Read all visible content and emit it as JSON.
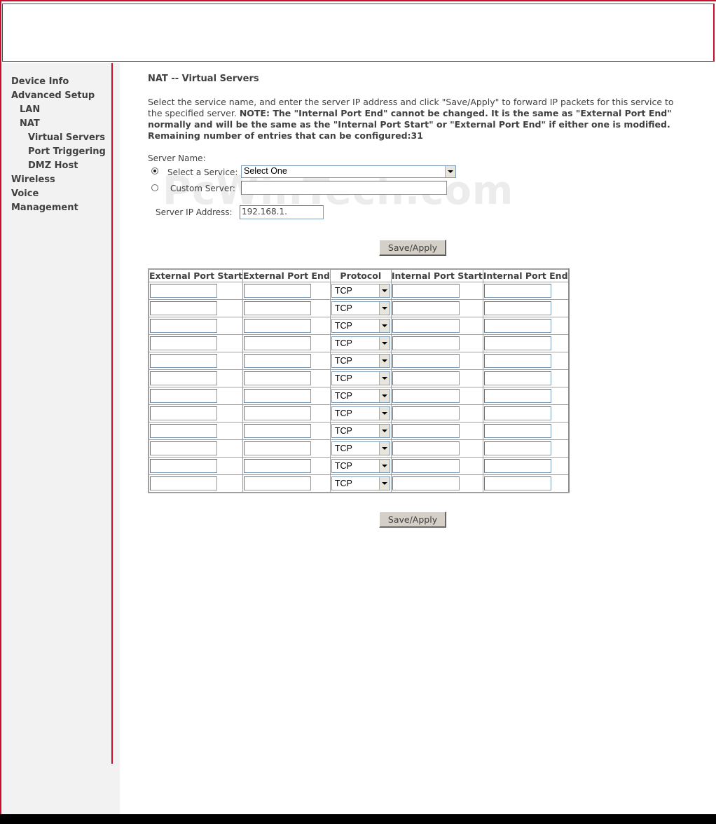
{
  "sidebar": {
    "items": [
      {
        "label": "Device Info"
      },
      {
        "label": "Advanced Setup"
      },
      {
        "label": "LAN"
      },
      {
        "label": "NAT"
      },
      {
        "label": "Virtual Servers"
      },
      {
        "label": "Port Triggering"
      },
      {
        "label": "DMZ Host"
      },
      {
        "label": "Wireless"
      },
      {
        "label": "Voice"
      },
      {
        "label": "Management"
      }
    ]
  },
  "page": {
    "title": "NAT -- Virtual Servers",
    "desc_part1": "Select the service name, and enter the server IP address and click \"Save/Apply\" to forward IP packets for this service to the specified server. ",
    "desc_note": "NOTE: The \"Internal Port End\" cannot be changed. It is the same as \"External Port End\" normally and will be the same as the \"Internal Port Start\" or \"External Port End\" if either one is modified.",
    "remaining": "Remaining number of entries that can be configured:31"
  },
  "form": {
    "server_name_label": "Server Name:",
    "select_service_label": "Select a Service:",
    "select_service_value": "Select One",
    "custom_server_label": "Custom Server:",
    "custom_server_value": "",
    "server_ip_label": "Server IP Address:",
    "server_ip_value": "192.168.1.",
    "save_label": "Save/Apply"
  },
  "watermark": "PcWinTech.com",
  "table": {
    "headers": [
      "External Port Start",
      "External Port End",
      "Protocol",
      "Internal Port Start",
      "Internal Port End"
    ],
    "protocol_default": "TCP",
    "row_count": 12
  },
  "colors": {
    "accent": "#c8102e",
    "sidebar_bg": "#f2f2f2",
    "text": "#404040"
  }
}
